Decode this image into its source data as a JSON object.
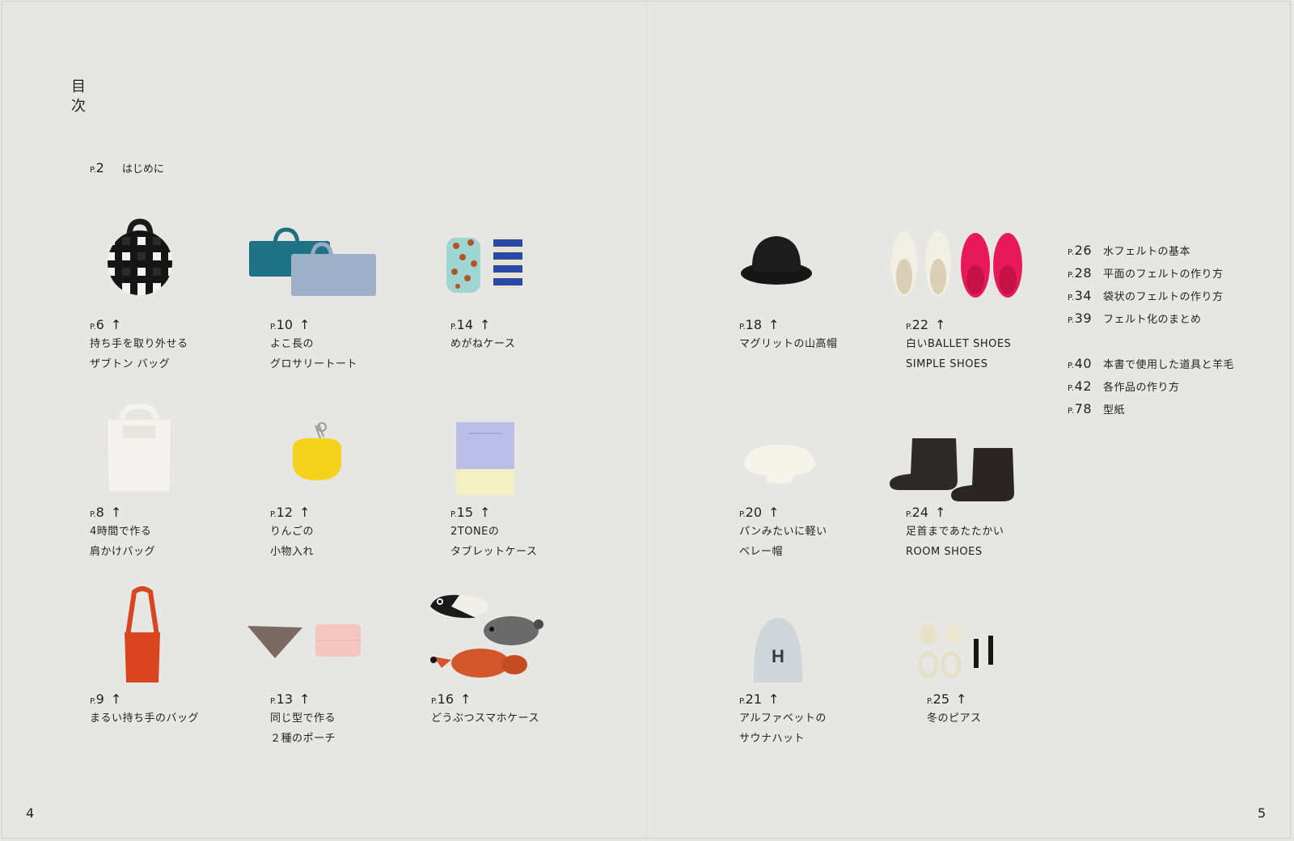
{
  "heading": {
    "line1": "目",
    "line2": "次"
  },
  "intro": {
    "page": "2",
    "title": "はじめに"
  },
  "page_prefix": "P.",
  "arrow_icon": "up-arrow-icon",
  "items": [
    {
      "page": "6",
      "line1": "持ち手を取り外せる",
      "line2": "ザブトン バッグ"
    },
    {
      "page": "10",
      "line1": "よこ長の",
      "line2": "グロサリートート"
    },
    {
      "page": "14",
      "line1": "めがねケース",
      "line2": ""
    },
    {
      "page": "18",
      "line1": "マグリットの山高帽",
      "line2": ""
    },
    {
      "page": "22",
      "line1": "白いBALLET SHOES",
      "line2": "SIMPLE SHOES"
    },
    {
      "page": "8",
      "line1": "4時間で作る",
      "line2": "肩かけバッグ"
    },
    {
      "page": "12",
      "line1": "りんごの",
      "line2": "小物入れ"
    },
    {
      "page": "15",
      "line1": "2TONEの",
      "line2": "タブレットケース"
    },
    {
      "page": "20",
      "line1": "パンみたいに軽い",
      "line2": "ベレー帽"
    },
    {
      "page": "24",
      "line1": "足首まであたたかい",
      "line2": "ROOM SHOES"
    },
    {
      "page": "9",
      "line1": "まるい持ち手のバッグ",
      "line2": ""
    },
    {
      "page": "13",
      "line1": "同じ型で作る",
      "line2": "２種のポーチ"
    },
    {
      "page": "16",
      "line1": "どうぶつスマホケース",
      "line2": ""
    },
    {
      "page": "21",
      "line1": "アルファベットの",
      "line2": "サウナハット"
    },
    {
      "page": "25",
      "line1": "冬のピアス",
      "line2": ""
    }
  ],
  "sauna_letter": "H",
  "right_list": [
    {
      "page": "26",
      "title": "水フェルトの基本"
    },
    {
      "page": "28",
      "title": "平面のフェルトの作り方"
    },
    {
      "page": "34",
      "title": "袋状のフェルトの作り方"
    },
    {
      "page": "39",
      "title": "フェルト化のまとめ"
    },
    {
      "page": "40",
      "title": "本書で使用した道具と羊毛"
    },
    {
      "page": "42",
      "title": "各作品の作り方"
    },
    {
      "page": "78",
      "title": "型紙"
    }
  ],
  "page_numbers": {
    "left": "4",
    "right": "5"
  },
  "colors": {
    "background": "#e6e6e4",
    "text": "#222222"
  }
}
